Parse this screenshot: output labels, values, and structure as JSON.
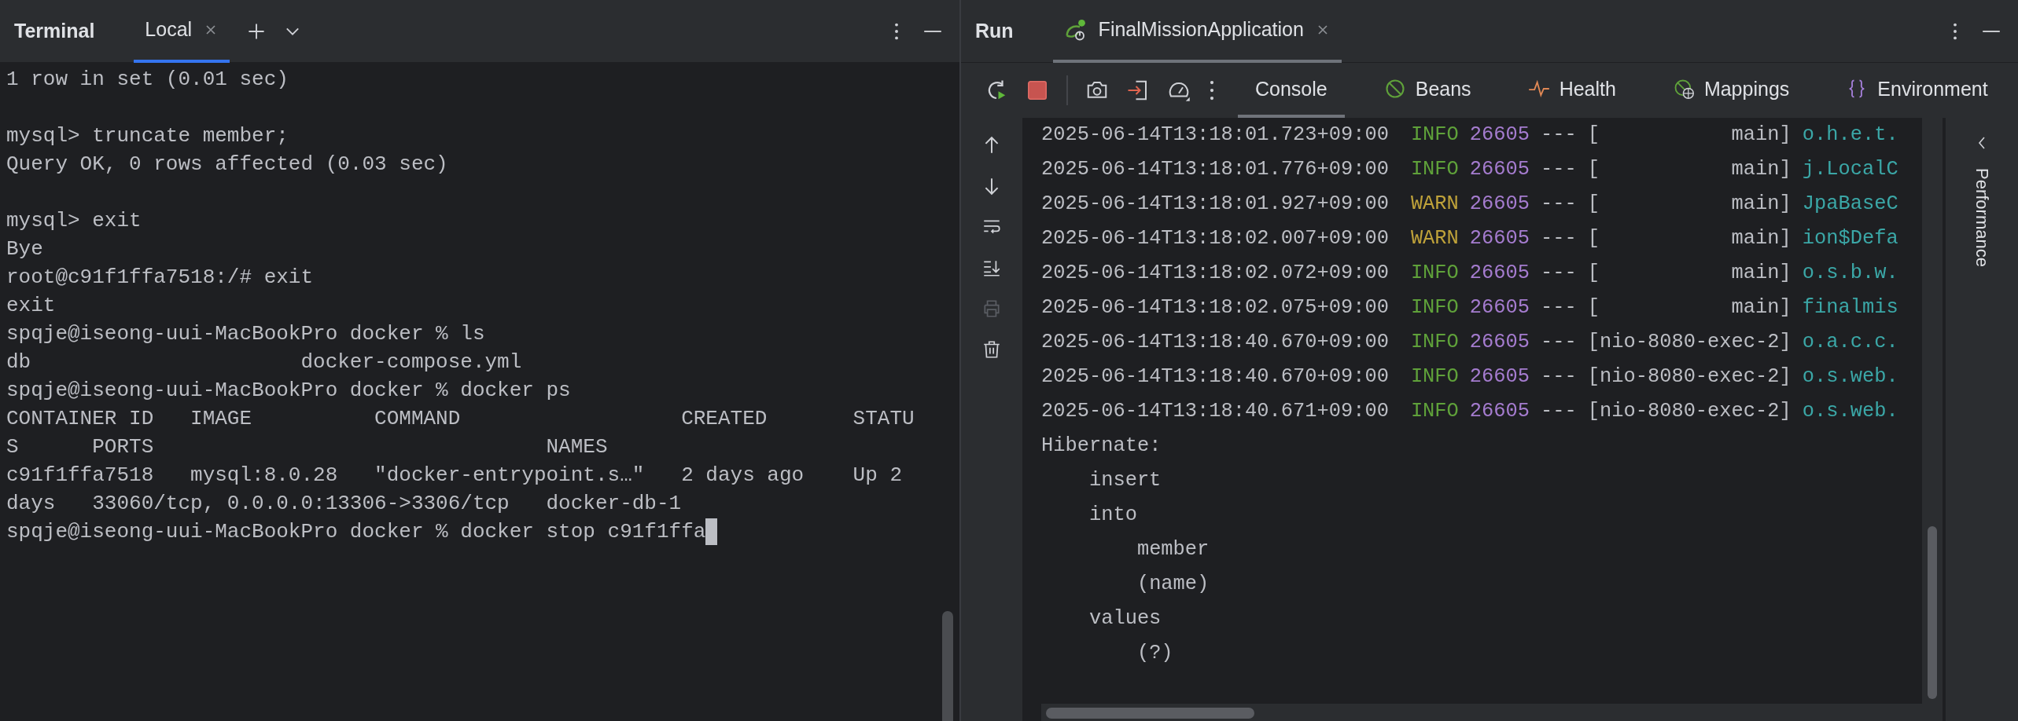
{
  "terminal": {
    "title": "Terminal",
    "tabs": [
      {
        "label": "Local",
        "selected": true
      }
    ],
    "blocks": [
      [
        "1 row in set (0.01 sec)"
      ],
      [
        "mysql> truncate member;",
        "Query OK, 0 rows affected (0.03 sec)"
      ],
      [
        "mysql> exit",
        "Bye",
        "root@c91f1ffa7518:/# exit",
        "exit",
        "spqje@iseong-uui-MacBookPro docker % ls",
        "db                      docker-compose.yml",
        "spqje@iseong-uui-MacBookPro docker % docker ps",
        "CONTAINER ID   IMAGE          COMMAND                  CREATED       STATU",
        "S      PORTS                                NAMES",
        "c91f1ffa7518   mysql:8.0.28   \"docker-entrypoint.s…\"   2 days ago    Up 2",
        "days   33060/tcp, 0.0.0.0:13306->3306/tcp   docker-db-1",
        "spqje@iseong-uui-MacBookPro docker % docker stop c91f1ffa"
      ]
    ],
    "cursor": true
  },
  "run": {
    "title": "Run",
    "tabs": [
      {
        "label": "FinalMissionApplication",
        "selected": true
      }
    ],
    "gutter_tools": [
      {
        "kind": "up",
        "disabled": false
      },
      {
        "kind": "down",
        "disabled": false
      },
      {
        "kind": "wrap",
        "disabled": false
      },
      {
        "kind": "scroll-end",
        "disabled": false
      },
      {
        "kind": "print",
        "disabled": true
      },
      {
        "kind": "trash",
        "disabled": false
      }
    ],
    "views": [
      {
        "label": "Console",
        "kind": "console",
        "selected": true
      },
      {
        "label": "Beans",
        "kind": "beans",
        "selected": false
      },
      {
        "label": "Health",
        "kind": "health",
        "selected": false
      },
      {
        "label": "Mappings",
        "kind": "mappings",
        "selected": false
      },
      {
        "label": "Environment",
        "kind": "environment",
        "selected": false
      }
    ],
    "log": [
      {
        "timestamp": "2025-06-14T13:18:01.723+09:00",
        "level": "INFO",
        "kind": "info",
        "pid": "26605",
        "separator": "---",
        "thread": "[           main]",
        "logger": "o.h.e.t."
      },
      {
        "timestamp": "2025-06-14T13:18:01.776+09:00",
        "level": "INFO",
        "kind": "info",
        "pid": "26605",
        "separator": "---",
        "thread": "[           main]",
        "logger": "j.LocalC"
      },
      {
        "timestamp": "2025-06-14T13:18:01.927+09:00",
        "level": "WARN",
        "kind": "warn",
        "pid": "26605",
        "separator": "---",
        "thread": "[           main]",
        "logger": "JpaBaseC"
      },
      {
        "timestamp": "2025-06-14T13:18:02.007+09:00",
        "level": "WARN",
        "kind": "warn",
        "pid": "26605",
        "separator": "---",
        "thread": "[           main]",
        "logger": "ion$Defa"
      },
      {
        "timestamp": "2025-06-14T13:18:02.072+09:00",
        "level": "INFO",
        "kind": "info",
        "pid": "26605",
        "separator": "---",
        "thread": "[           main]",
        "logger": "o.s.b.w."
      },
      {
        "timestamp": "2025-06-14T13:18:02.075+09:00",
        "level": "INFO",
        "kind": "info",
        "pid": "26605",
        "separator": "---",
        "thread": "[           main]",
        "logger": "finalmis"
      },
      {
        "timestamp": "2025-06-14T13:18:40.670+09:00",
        "level": "INFO",
        "kind": "info",
        "pid": "26605",
        "separator": "---",
        "thread": "[nio-8080-exec-2]",
        "logger": "o.a.c.c."
      },
      {
        "timestamp": "2025-06-14T13:18:40.670+09:00",
        "level": "INFO",
        "kind": "info",
        "pid": "26605",
        "separator": "---",
        "thread": "[nio-8080-exec-2]",
        "logger": "o.s.web."
      },
      {
        "timestamp": "2025-06-14T13:18:40.671+09:00",
        "level": "INFO",
        "kind": "info",
        "pid": "26605",
        "separator": "---",
        "thread": "[nio-8080-exec-2]",
        "logger": "o.s.web."
      }
    ],
    "sql": [
      {
        "text": "Hibernate:",
        "children": [
          {
            "text": "insert"
          },
          {
            "text": "into",
            "children": [
              {
                "text": "member"
              },
              {
                "text": "(name)"
              }
            ]
          },
          {
            "text": "values",
            "children": [
              {
                "text": "(?)"
              }
            ]
          }
        ]
      }
    ],
    "side_tab": "Performance"
  }
}
